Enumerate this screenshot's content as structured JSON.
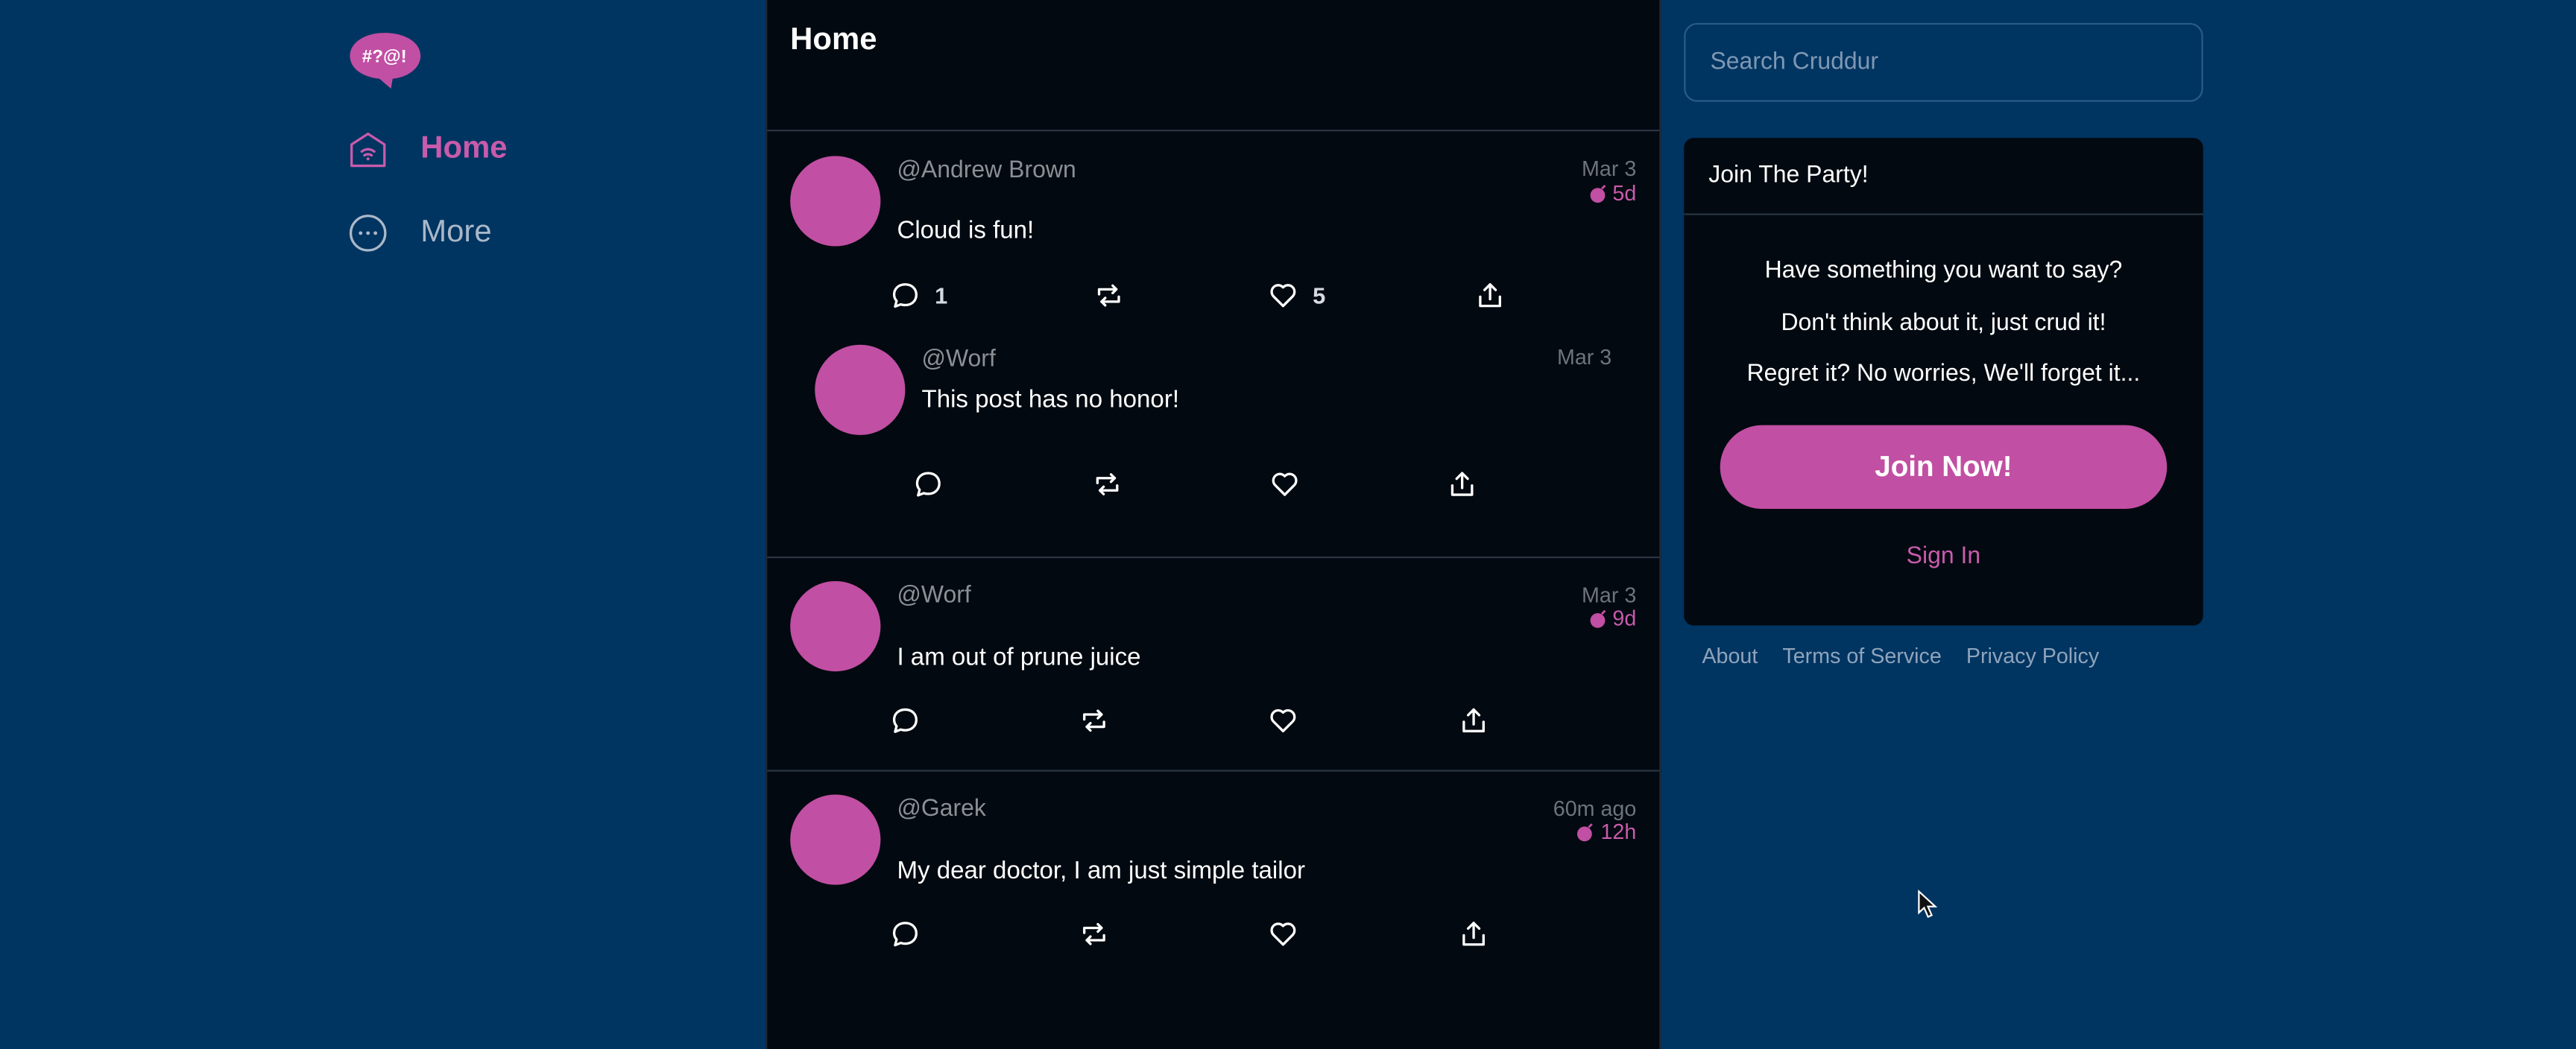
{
  "app": {
    "logo_text": "#?@!",
    "brand_color": "#c14fa3",
    "background_color": "#003461",
    "feed_background": "#020910"
  },
  "sidebar": {
    "items": [
      {
        "label": "Home",
        "icon": "home-icon",
        "active": true
      },
      {
        "label": "More",
        "icon": "more-icon",
        "active": false
      }
    ]
  },
  "feed": {
    "title": "Home",
    "posts": [
      {
        "handle": "@Andrew Brown",
        "date": "Mar 3",
        "expires": "5d",
        "content": "Cloud is fun!",
        "reply_count": "1",
        "like_count": "5",
        "reply": {
          "handle": "@Worf",
          "date": "Mar 3",
          "content": "This post has no honor!"
        }
      },
      {
        "handle": "@Worf",
        "date": "Mar 3",
        "expires": "9d",
        "content": "I am out of prune juice"
      },
      {
        "handle": "@Garek",
        "date": "60m ago",
        "expires": "12h",
        "content": "My dear doctor, I am just simple tailor"
      }
    ]
  },
  "search": {
    "placeholder": "Search Cruddur",
    "value": ""
  },
  "join": {
    "title": "Join The Party!",
    "lines": [
      "Have something you want to say?",
      "Don't think about it, just crud it!",
      "Regret it? No worries, We'll forget it..."
    ],
    "button_label": "Join Now!",
    "signin_label": "Sign In"
  },
  "footer": {
    "links": [
      "About",
      "Terms of Service",
      "Privacy Policy"
    ]
  }
}
